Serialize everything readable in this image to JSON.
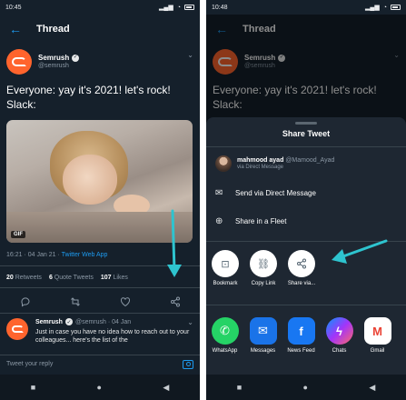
{
  "left": {
    "status": {
      "time": "10:45",
      "battery_icon": "battery-icon"
    },
    "header": {
      "back_icon": "←",
      "title": "Thread"
    },
    "tweet": {
      "name": "Semrush",
      "handle": "@semrush",
      "text_line1": "Everyone: yay it's 2021! let's rock!",
      "text_line2": "Slack:",
      "gif_label": "GIF",
      "timestamp": "16:21 · 04 Jan 21 · ",
      "source": "Twitter Web App",
      "retweets_count": "20",
      "retweets_label": "Retweets",
      "quotes_count": "6",
      "quotes_label": "Quote Tweets",
      "likes_count": "107",
      "likes_label": "Likes"
    },
    "actions": {
      "reply_icon": "reply-icon",
      "retweet_icon": "retweet-icon",
      "like_icon": "like-icon",
      "share_icon": "share-icon"
    },
    "reply_tweet": {
      "name": "Semrush",
      "handle": "@semrush · 04 Jan",
      "text": "Just in case you have no idea how to reach out to your colleagues... here's the list of the"
    },
    "compose": {
      "placeholder": "Tweet your reply"
    }
  },
  "right": {
    "status": {
      "time": "10:48"
    },
    "header": {
      "title": "Thread"
    },
    "tweet": {
      "name": "Semrush",
      "handle": "@semrush",
      "text_line1": "Everyone: yay it's 2021! let's rock!",
      "text_line2": "Slack:"
    },
    "sheet": {
      "title": "Share Tweet",
      "contact_name": "mahmood ayad",
      "contact_handle": "@Mamood_Ayad",
      "contact_via": "via Direct Message",
      "dm_label": "Send via Direct Message",
      "fleet_label": "Share in a Fleet",
      "bookmark_label": "Bookmark",
      "copy_link_label": "Copy Link",
      "share_via_label": "Share via...",
      "apps": [
        {
          "label": "WhatsApp",
          "glyph": "✆",
          "color": "#25d366"
        },
        {
          "label": "Messages",
          "glyph": "✉",
          "color": "#1a73e8"
        },
        {
          "label": "News Feed",
          "glyph": "f",
          "color": "#1877f2"
        },
        {
          "label": "Chats",
          "glyph": "ϟ",
          "color": "#a334fa"
        },
        {
          "label": "Gmail",
          "glyph": "M",
          "color": "#ffffff"
        }
      ]
    }
  },
  "colors": {
    "accent": "#1d9bf0",
    "background": "#15202b",
    "arrow": "#2ec4cf",
    "brand_orange": "#ff642d"
  }
}
